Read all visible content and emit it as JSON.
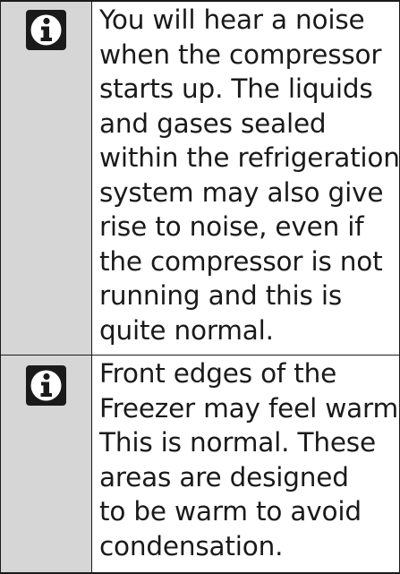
{
  "notes": [
    {
      "icon": "info-icon",
      "lines": [
        "You will hear a noise",
        "when the compressor",
        "starts up. The liquids",
        "and gases sealed",
        "within the refrigeration",
        "system may also give",
        "rise to noise, even if",
        "the compressor is not",
        "running and this is",
        "quite normal."
      ]
    },
    {
      "icon": "info-icon",
      "lines": [
        "Front edges of the",
        "Freezer may feel warm.",
        "This is normal. These",
        "areas are designed",
        "to be warm to avoid",
        "condensation."
      ]
    }
  ],
  "colors": {
    "icon_background": "#d6d6d6",
    "ink": "#1a1a1a"
  }
}
